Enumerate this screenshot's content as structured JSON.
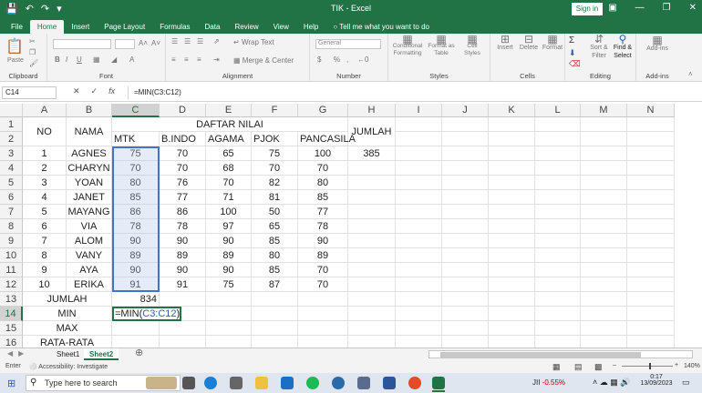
{
  "window": {
    "title": "TIK  -  Excel",
    "signin": "Sign in"
  },
  "ribbon_tabs": [
    "File",
    "Home",
    "Insert",
    "Page Layout",
    "Formulas",
    "Data",
    "Review",
    "View",
    "Help"
  ],
  "tell_me": "Tell me what you want to do",
  "ribbon": {
    "groups": [
      "Clipboard",
      "Font",
      "Alignment",
      "Number",
      "Styles",
      "Cells",
      "Editing",
      "Add-ins"
    ],
    "wrap_text": "Wrap Text",
    "merge_center": "Merge & Center",
    "number_format": "General",
    "styles_buttons": [
      "Conditional Formatting",
      "Format as Table",
      "Cell Styles"
    ],
    "cells_buttons": [
      "Insert",
      "Delete",
      "Format"
    ],
    "editing_buttons": [
      "Sort & Filter",
      "Find & Select"
    ],
    "addins_button": "Add-ins",
    "paste": "Paste"
  },
  "formula_bar": {
    "name_box": "C14",
    "formula": "=MIN(C3:C12)"
  },
  "columns": [
    "A",
    "B",
    "C",
    "D",
    "E",
    "F",
    "G",
    "H",
    "I",
    "J",
    "K",
    "L",
    "M",
    "N"
  ],
  "rows": [
    "1",
    "2",
    "3",
    "4",
    "5",
    "6",
    "7",
    "8",
    "9",
    "10",
    "11",
    "12",
    "13",
    "14",
    "15",
    "16"
  ],
  "sheet": {
    "title": "DAFTAR NILAI",
    "no_header": "NO",
    "name_header": "NAMA",
    "subject_headers": [
      "MTK",
      "B.INDO",
      "AGAMA",
      "PJOK",
      "PANCASILA"
    ],
    "total_header": "JUMLAH",
    "students": [
      {
        "no": "1",
        "name": "AGNES",
        "scores": [
          "75",
          "70",
          "65",
          "75",
          "100"
        ],
        "total": "385"
      },
      {
        "no": "2",
        "name": "CHARYN",
        "scores": [
          "70",
          "70",
          "68",
          "70",
          "70"
        ],
        "total": ""
      },
      {
        "no": "3",
        "name": "YOAN",
        "scores": [
          "80",
          "76",
          "70",
          "82",
          "80"
        ],
        "total": ""
      },
      {
        "no": "4",
        "name": "JANET",
        "scores": [
          "85",
          "77",
          "71",
          "81",
          "85"
        ],
        "total": ""
      },
      {
        "no": "5",
        "name": "MAYANG",
        "scores": [
          "86",
          "86",
          "100",
          "50",
          "77"
        ],
        "total": ""
      },
      {
        "no": "6",
        "name": "VIA",
        "scores": [
          "78",
          "78",
          "97",
          "65",
          "78"
        ],
        "total": ""
      },
      {
        "no": "7",
        "name": "ALOM",
        "scores": [
          "90",
          "90",
          "90",
          "85",
          "90"
        ],
        "total": ""
      },
      {
        "no": "8",
        "name": "VANY",
        "scores": [
          "89",
          "89",
          "89",
          "80",
          "89"
        ],
        "total": ""
      },
      {
        "no": "9",
        "name": "AYA",
        "scores": [
          "90",
          "90",
          "90",
          "85",
          "70"
        ],
        "total": ""
      },
      {
        "no": "10",
        "name": "ERIKA",
        "scores": [
          "91",
          "91",
          "75",
          "87",
          "70"
        ],
        "total": ""
      }
    ],
    "summary": [
      {
        "label": "JUMLAH",
        "value": "834"
      },
      {
        "label": "MIN",
        "value": ""
      },
      {
        "label": "MAX",
        "value": ""
      },
      {
        "label": "RATA-RATA",
        "value": ""
      }
    ],
    "edit_prefix": "=MIN(",
    "edit_ref": "C3:C12",
    "edit_suffix": ")"
  },
  "sheet_tabs": [
    "Sheet1",
    "Sheet2"
  ],
  "active_sheet": "Sheet2",
  "status": {
    "mode": "Enter",
    "accessibility": "Accessibility: Investigate",
    "zoom": "140%"
  },
  "taskbar": {
    "search_placeholder": "Type here to search",
    "stock": "JII",
    "stock_change": "-0.55%",
    "time": "0:17",
    "date": "13/09/2023"
  },
  "colors": {
    "excel_green": "#217346",
    "selection_blue": "#4472c4",
    "negative_red": "#c00000"
  }
}
